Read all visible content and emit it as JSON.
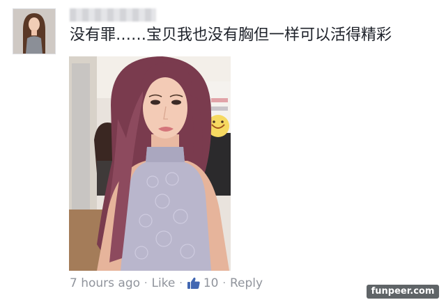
{
  "comment": {
    "text": "没有罪……宝贝我也没有胸但一样可以活得精彩"
  },
  "meta": {
    "timestamp": "7 hours ago",
    "separator": "·",
    "like_label": "Like",
    "like_count": "10",
    "reply_label": "Reply"
  },
  "icons": {
    "like": "thumbs-up-icon"
  },
  "colors": {
    "text": "#1d2129",
    "meta_text": "#90949c",
    "like_blue": "#4267b2"
  },
  "watermark": {
    "text": "funpeer.com"
  }
}
